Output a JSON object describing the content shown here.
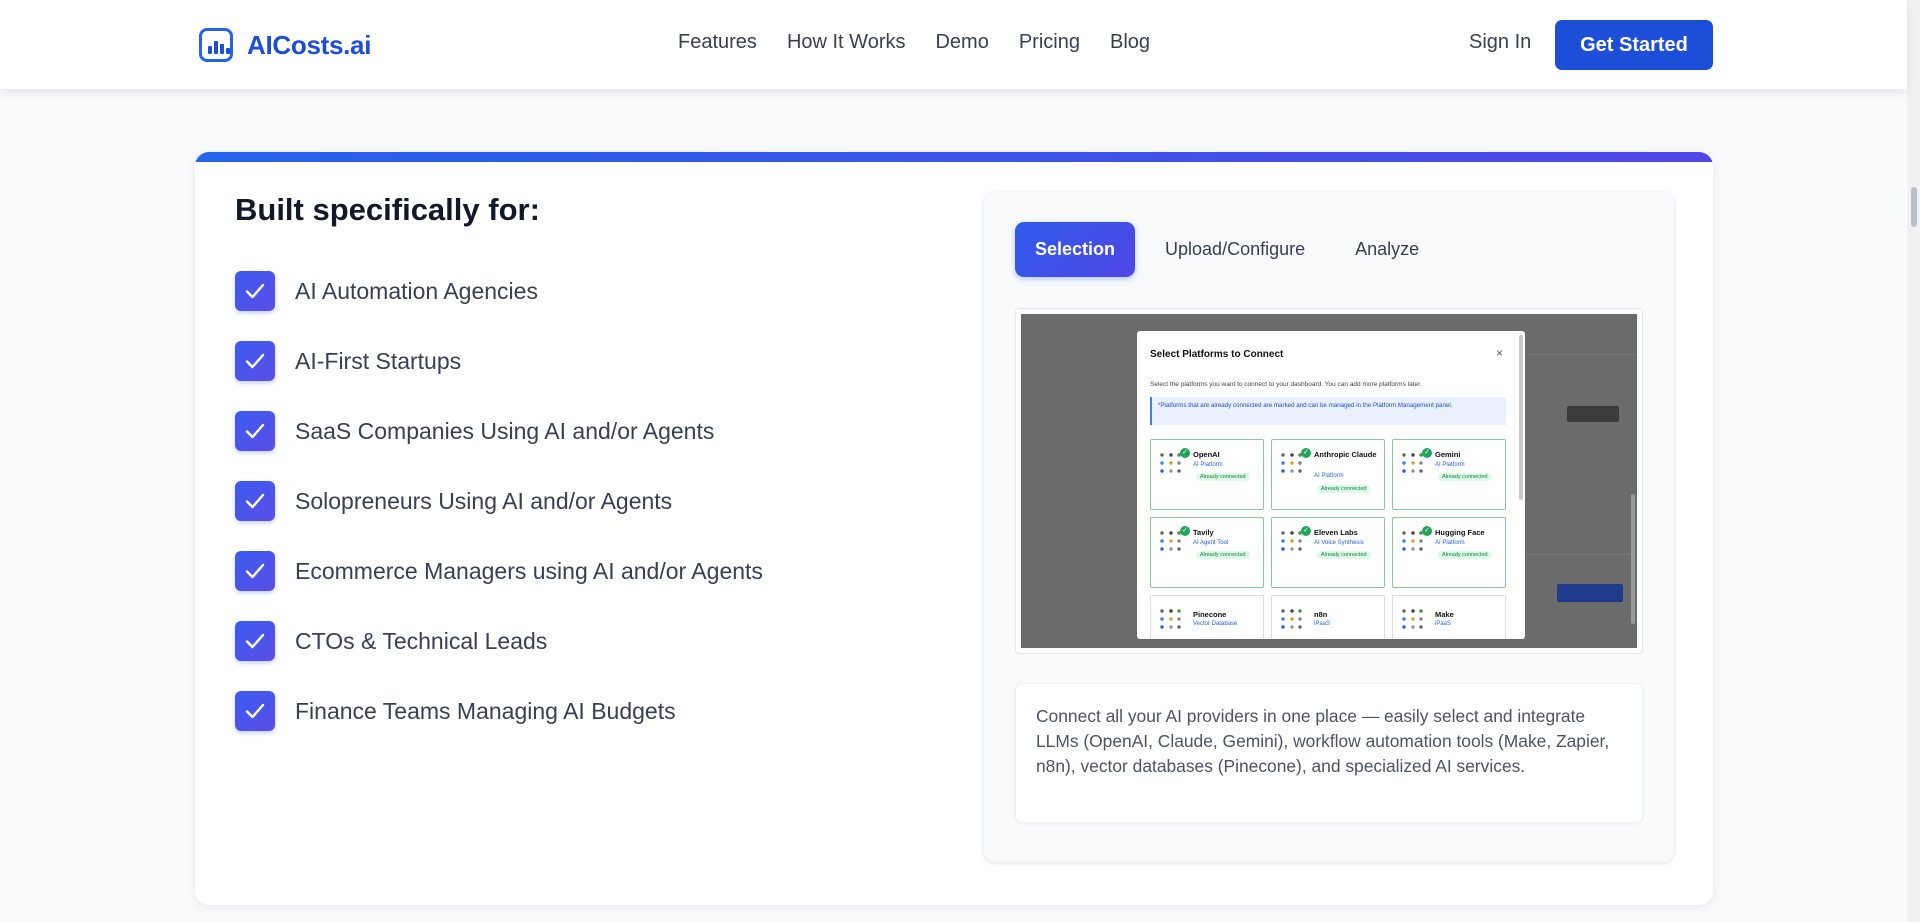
{
  "header": {
    "logo_text": "AICosts.ai",
    "nav": [
      "Features",
      "How It Works",
      "Demo",
      "Pricing",
      "Blog"
    ],
    "sign_in": "Sign In",
    "get_started": "Get Started"
  },
  "section": {
    "title": "Built specifically for:",
    "audiences": [
      "AI Automation Agencies",
      "AI-First Startups",
      "SaaS Companies Using AI and/or Agents",
      "Solopreneurs Using AI and/or Agents",
      "Ecommerce Managers using AI and/or Agents",
      "CTOs & Technical Leads",
      "Finance Teams Managing AI Budgets"
    ]
  },
  "demo": {
    "tabs": [
      "Selection",
      "Upload/Configure",
      "Analyze"
    ],
    "active_tab": "Selection",
    "screenshot": {
      "modal_title": "Select Platforms to Connect",
      "close_glyph": "×",
      "subtitle": "Select the platforms you want to connect to your dashboard. You can add more platforms later.",
      "note": "*Platforms that are already connected are marked and can be managed in the Platform Management panel.",
      "badge": "Already connected",
      "platforms": [
        {
          "name": "OpenAI",
          "type": "AI Platform",
          "connected": true
        },
        {
          "name": "Anthropic Claude",
          "type": "AI Platform",
          "connected": true
        },
        {
          "name": "Gemini",
          "type": "AI Platform",
          "connected": true
        },
        {
          "name": "Tavily",
          "type": "AI Agent Tool",
          "connected": true
        },
        {
          "name": "Eleven Labs",
          "type": "AI Voice Synthesis",
          "connected": true
        },
        {
          "name": "Hugging Face",
          "type": "AI Platform",
          "connected": true
        },
        {
          "name": "Pinecone",
          "type": "Vector Database",
          "connected": false
        },
        {
          "name": "n8n",
          "type": "iPaaS",
          "connected": false
        },
        {
          "name": "Make",
          "type": "iPaaS",
          "connected": false
        }
      ]
    },
    "description": "Connect all your AI providers in one place — easily select and integrate LLMs (OpenAI, Claude, Gemini), workflow automation tools (Make, Zapier, n8n), vector databases (Pinecone), and specialized AI services."
  },
  "colors": {
    "brand": "#1d4ed8",
    "accent_gradient_start": "#2563eb",
    "accent_gradient_end": "#4f46e5",
    "connected_green": "#22a55b"
  }
}
